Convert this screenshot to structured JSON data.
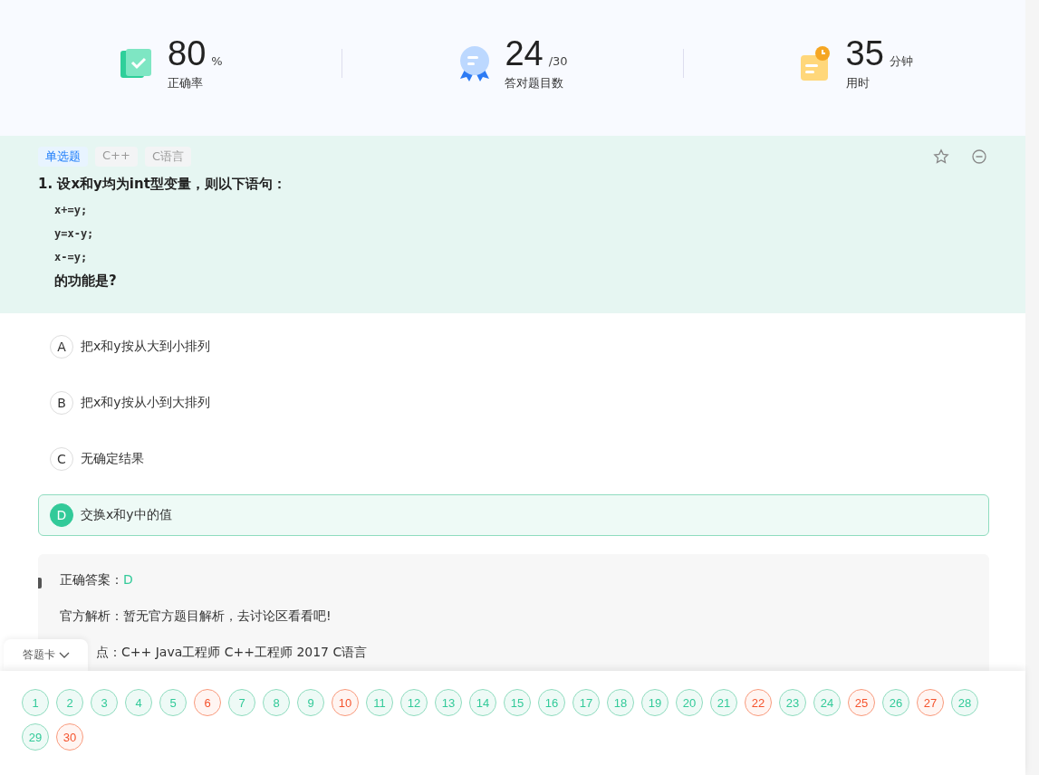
{
  "stats": [
    {
      "kind": "accuracy",
      "value": "80",
      "unit": "%",
      "label": "正确率"
    },
    {
      "kind": "correct",
      "value": "24",
      "unit": "/30",
      "label": "答对题目数"
    },
    {
      "kind": "time",
      "value": "35",
      "unit": "分钟",
      "label": "用时"
    }
  ],
  "question": {
    "tags": [
      {
        "label": "单选题",
        "kind": "type"
      },
      {
        "label": "C++",
        "kind": "topic"
      },
      {
        "label": "C语言",
        "kind": "topic"
      }
    ],
    "number": "1.",
    "title": "设x和y均为int型变量，则以下语句：",
    "code": [
      "x+=y;",
      "y=x-y;",
      "x-=y;"
    ],
    "ending": "的功能是?",
    "favorited": false,
    "options": [
      {
        "letter": "A",
        "text": "把x和y按从大到小排列",
        "selected": false
      },
      {
        "letter": "B",
        "text": "把x和y按从小到大排列",
        "selected": false
      },
      {
        "letter": "C",
        "text": "无确定结果",
        "selected": false
      },
      {
        "letter": "D",
        "text": "交换x和y中的值",
        "selected": true
      }
    ]
  },
  "analysis": {
    "answer_label": "正确答案：",
    "answer": "D",
    "official": "官方解析：暂无官方题目解析，去讨论区看看吧!",
    "points": "点：C++   Java工程师   C++工程师   2017   C语言"
  },
  "answer_card": {
    "title": "答题卡",
    "expanded": true,
    "items": [
      {
        "number": "1",
        "correct": true
      },
      {
        "number": "2",
        "correct": true
      },
      {
        "number": "3",
        "correct": true
      },
      {
        "number": "4",
        "correct": true
      },
      {
        "number": "5",
        "correct": true
      },
      {
        "number": "6",
        "correct": false
      },
      {
        "number": "7",
        "correct": true
      },
      {
        "number": "8",
        "correct": true
      },
      {
        "number": "9",
        "correct": true
      },
      {
        "number": "10",
        "correct": false
      },
      {
        "number": "11",
        "correct": true
      },
      {
        "number": "12",
        "correct": true
      },
      {
        "number": "13",
        "correct": true
      },
      {
        "number": "14",
        "correct": true
      },
      {
        "number": "15",
        "correct": true
      },
      {
        "number": "16",
        "correct": true
      },
      {
        "number": "17",
        "correct": true
      },
      {
        "number": "18",
        "correct": true
      },
      {
        "number": "19",
        "correct": true
      },
      {
        "number": "20",
        "correct": true
      },
      {
        "number": "21",
        "correct": true
      },
      {
        "number": "22",
        "correct": false
      },
      {
        "number": "23",
        "correct": true
      },
      {
        "number": "24",
        "correct": true
      },
      {
        "number": "25",
        "correct": false
      },
      {
        "number": "26",
        "correct": true
      },
      {
        "number": "27",
        "correct": false
      },
      {
        "number": "28",
        "correct": true
      },
      {
        "number": "29",
        "correct": true
      },
      {
        "number": "30",
        "correct": false
      }
    ]
  }
}
